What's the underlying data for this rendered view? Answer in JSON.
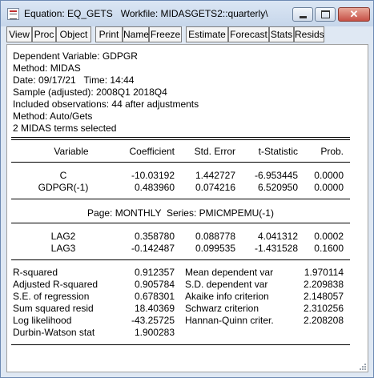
{
  "window": {
    "title": "Equation: EQ_GETS   Workfile: MIDASGETS2::quarterly\\"
  },
  "toolbar": {
    "buttons": [
      "View",
      "Proc",
      "Object",
      "Print",
      "Name",
      "Freeze",
      "Estimate",
      "Forecast",
      "Stats",
      "Resids"
    ]
  },
  "header": {
    "lines": [
      "Dependent Variable: GDPGR",
      "Method: MIDAS",
      "Date: 09/17/21   Time: 14:44",
      "Sample (adjusted): 2008Q1 2018Q4",
      "Included observations: 44 after adjustments",
      "Method: Auto/Gets",
      "2 MIDAS terms selected"
    ]
  },
  "table": {
    "columns": [
      "Variable",
      "Coefficient",
      "Std. Error",
      "t-Statistic",
      "Prob."
    ],
    "rows": [
      [
        "C",
        "-10.03192",
        "1.442727",
        "-6.953445",
        "0.0000"
      ],
      [
        "GDPGR(-1)",
        "0.483960",
        "0.074216",
        "6.520950",
        "0.0000"
      ]
    ],
    "page_label": "Page: MONTHLY  Series: PMICMPEMU(-1)",
    "midas_rows": [
      [
        "LAG2",
        "0.358780",
        "0.088778",
        "4.041312",
        "0.0002"
      ],
      [
        "LAG3",
        "-0.142487",
        "0.099535",
        "-1.431528",
        "0.1600"
      ]
    ]
  },
  "stats": {
    "left": [
      [
        "R-squared",
        "0.912357"
      ],
      [
        "Adjusted R-squared",
        "0.905784"
      ],
      [
        "S.E. of regression",
        "0.678301"
      ],
      [
        "Sum squared resid",
        "18.40369"
      ],
      [
        "Log likelihood",
        "-43.25725"
      ],
      [
        "Durbin-Watson stat",
        "1.900283"
      ]
    ],
    "right": [
      [
        "Mean dependent var",
        "1.970114"
      ],
      [
        "S.D. dependent var",
        "2.209838"
      ],
      [
        "Akaike info criterion",
        "2.148057"
      ],
      [
        "Schwarz criterion",
        "2.310256"
      ],
      [
        "Hannan-Quinn criter.",
        "2.208208"
      ]
    ]
  }
}
